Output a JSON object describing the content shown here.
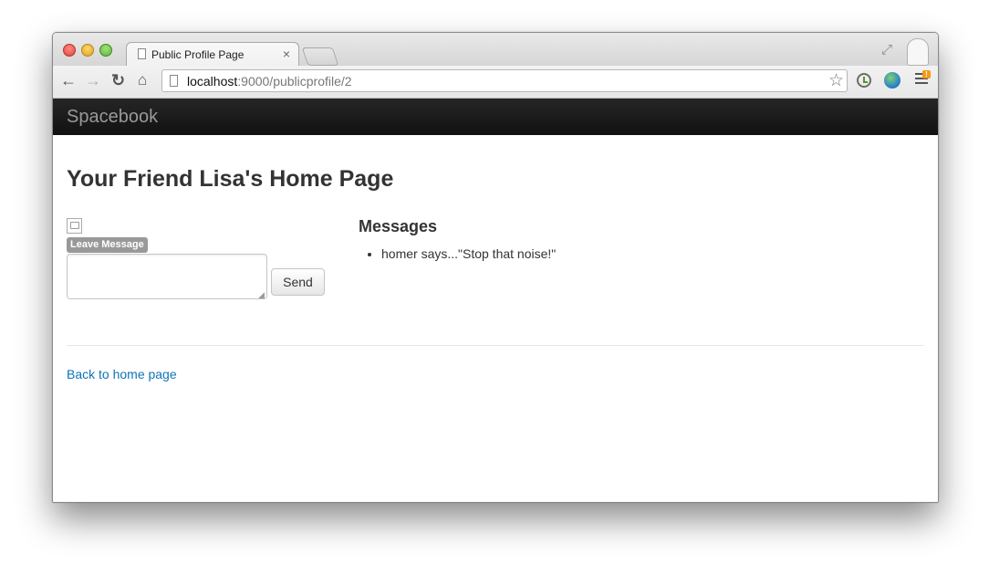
{
  "browser": {
    "tab_title": "Public Profile Page",
    "tab_close": "×",
    "url_host": "localhost",
    "url_path": ":9000/publicprofile/2",
    "icons": {
      "back": "back-arrow-icon",
      "forward": "forward-arrow-icon",
      "reload": "reload-icon",
      "home": "home-icon",
      "bookmark": "star-icon",
      "history": "clock-icon",
      "extension": "globe-icon",
      "menu": "menu-icon"
    },
    "menu_badge": "!"
  },
  "navbar": {
    "brand": "Spacebook"
  },
  "main": {
    "heading": "Your Friend Lisa's Home Page",
    "leave_message_label": "Leave Message",
    "message_input_value": "",
    "send_label": "Send",
    "messages_title": "Messages",
    "messages": [
      {
        "text": "homer says...\"Stop that noise!\""
      }
    ],
    "back_link": "Back to home page"
  },
  "colors": {
    "navbar_bg": "#1b1b1b",
    "brand_text": "#999999",
    "link": "#0f73b8",
    "label_bg": "#999999"
  }
}
